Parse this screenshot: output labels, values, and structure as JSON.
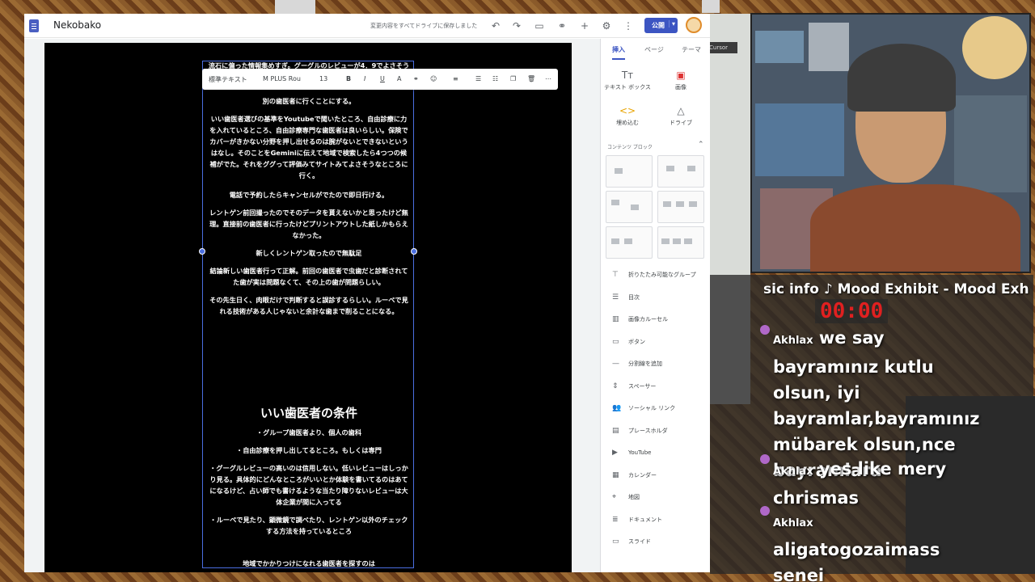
{
  "app": {
    "title": "Nekobako",
    "saved_status": "変更内容をすべてドライブに保存しました",
    "publish_label": "公開"
  },
  "toolbar": {
    "style": "標準テキスト",
    "font": "M PLUS Rou",
    "size": "13",
    "bold": "B",
    "italic": "I",
    "underline": "U",
    "color": "A"
  },
  "doc": {
    "p0": "流石に偏った情報集めすぎ。グーグルのレビューが4．9でよさそうかなと",
    "p1": "別の歯医者に行くことにする。",
    "p2": "いい歯医者選びの基準をYoutubeで聞いたところ、自由診療に力を入れているところ、自由診療専門な歯医者は良いらしい。保険でカバーがきかない分野を押し出せるのは腕がないとできないというはなし。そのことをGeminiに伝えて地域で検索したら4つつの候補がでた。それをググって評価みてサイトみてよさそうなところに行く。",
    "p3": "電話で予約したらキャンセルがでたので即日行ける。",
    "p4": "レントゲン前回撮ったのでそのデータを貰えないかと思ったけど無理。直接前の歯医者に行ったけどプリントアウトした紙しかもらえなかった。",
    "p5": "新しくレントゲン取ったので無駄足",
    "p6": "結論新しい歯医者行って正解。前回の歯医者で虫歯だと診断されてた歯が実は問題なくて、その上の歯が問題らしい。",
    "p7": "その先生日く、肉眼だけで判断すると誤診するらしい。ルーペで見れる技術がある人じゃないと余計な歯まで削ることになる。",
    "heading": "いい歯医者の条件",
    "b1": "・グループ歯医者より、個人の歯科",
    "b2": "・自由診療を押し出してるところ。もしくは専門",
    "b3": "・グーグルレビューの高いのは信用しない。低いレビューはしっかり見る。具体的にどんなところがいいとか体験を書いてるのはあてになるけど、占い師でも書けるような当たり障りないレビューは大体企業が間に入ってる",
    "b4": "・ルーペで見たり、顕微鏡で調べたり、レントゲン以外のチェックする方法を持っているところ",
    "p8": "地域でかかりつけになれる歯医者を探すのは"
  },
  "panel": {
    "tabs": [
      "挿入",
      "ページ",
      "テーマ"
    ],
    "top_items": [
      "テキスト ボックス",
      "画像",
      "埋め込む",
      "ドライブ"
    ],
    "content_blocks_label": "コンテンツ ブロック",
    "list": [
      "折りたたみ可能なグループ",
      "目次",
      "画像カルーセル",
      "ボタン",
      "分割線を追加",
      "スペーサー",
      "ソーシャル リンク",
      "プレースホルダ",
      "YouTube",
      "カレンダー",
      "地図",
      "ドキュメント",
      "スライド"
    ]
  },
  "overlay": {
    "music": "sic info ♪  Mood Exhibit - Mood Exh",
    "timer": "00:00",
    "chat": [
      {
        "user": "Akhlax",
        "msg": "we say bayramınız kutlu olsun, iyi bayramlar,bayramınız mübarek olsun,nce bayramlara"
      },
      {
        "user": "Akhlax",
        "msg": "yes like mery chrismas"
      },
      {
        "user": "Akhlax",
        "msg": "aligatogozaimass senei"
      }
    ],
    "cursor_tag": "Cursor"
  }
}
